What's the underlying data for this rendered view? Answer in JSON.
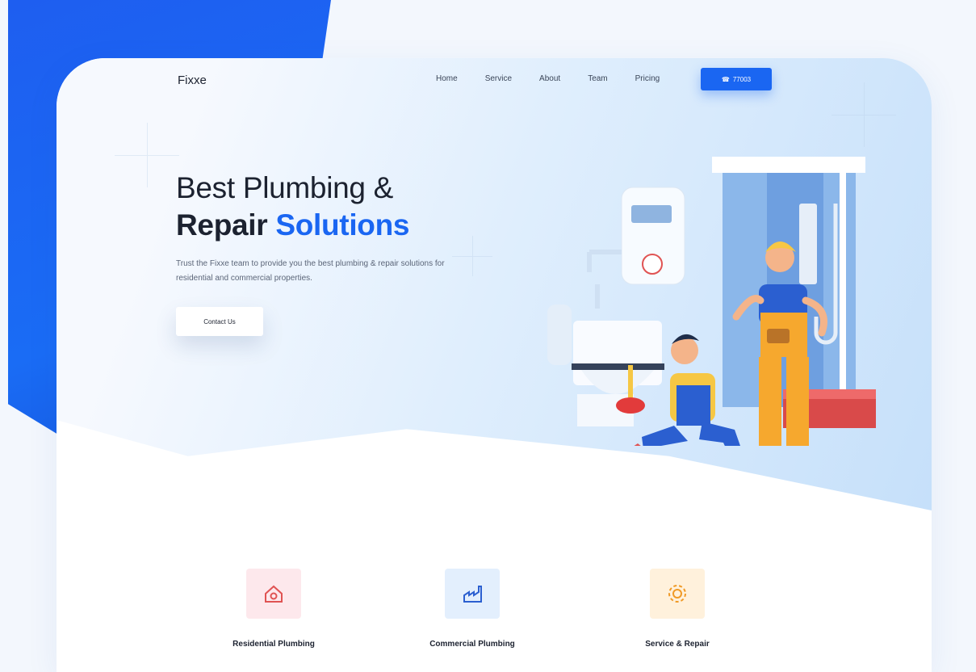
{
  "brand": {
    "logo": "Fixxe",
    "accent": "#1a66f2"
  },
  "nav": {
    "links": [
      "Home",
      "Service",
      "About",
      "Team",
      "Pricing"
    ],
    "call_label": "77003"
  },
  "hero": {
    "line1": "Best Plumbing &",
    "line2_bold": "Repair",
    "line2_accent": "Solutions",
    "subtext": "Trust the Fixxe team to provide you the best plumbing & repair solutions for residential and commercial properties.",
    "cta": "Contact Us"
  },
  "services": [
    {
      "title": "Residential Plumbing",
      "icon": "house-icon",
      "color": "#fde8ec"
    },
    {
      "title": "Commercial Plumbing",
      "icon": "factory-icon",
      "color": "#e3effd"
    },
    {
      "title": "Service & Repair",
      "icon": "gear-icon",
      "color": "#fff1dc"
    }
  ]
}
